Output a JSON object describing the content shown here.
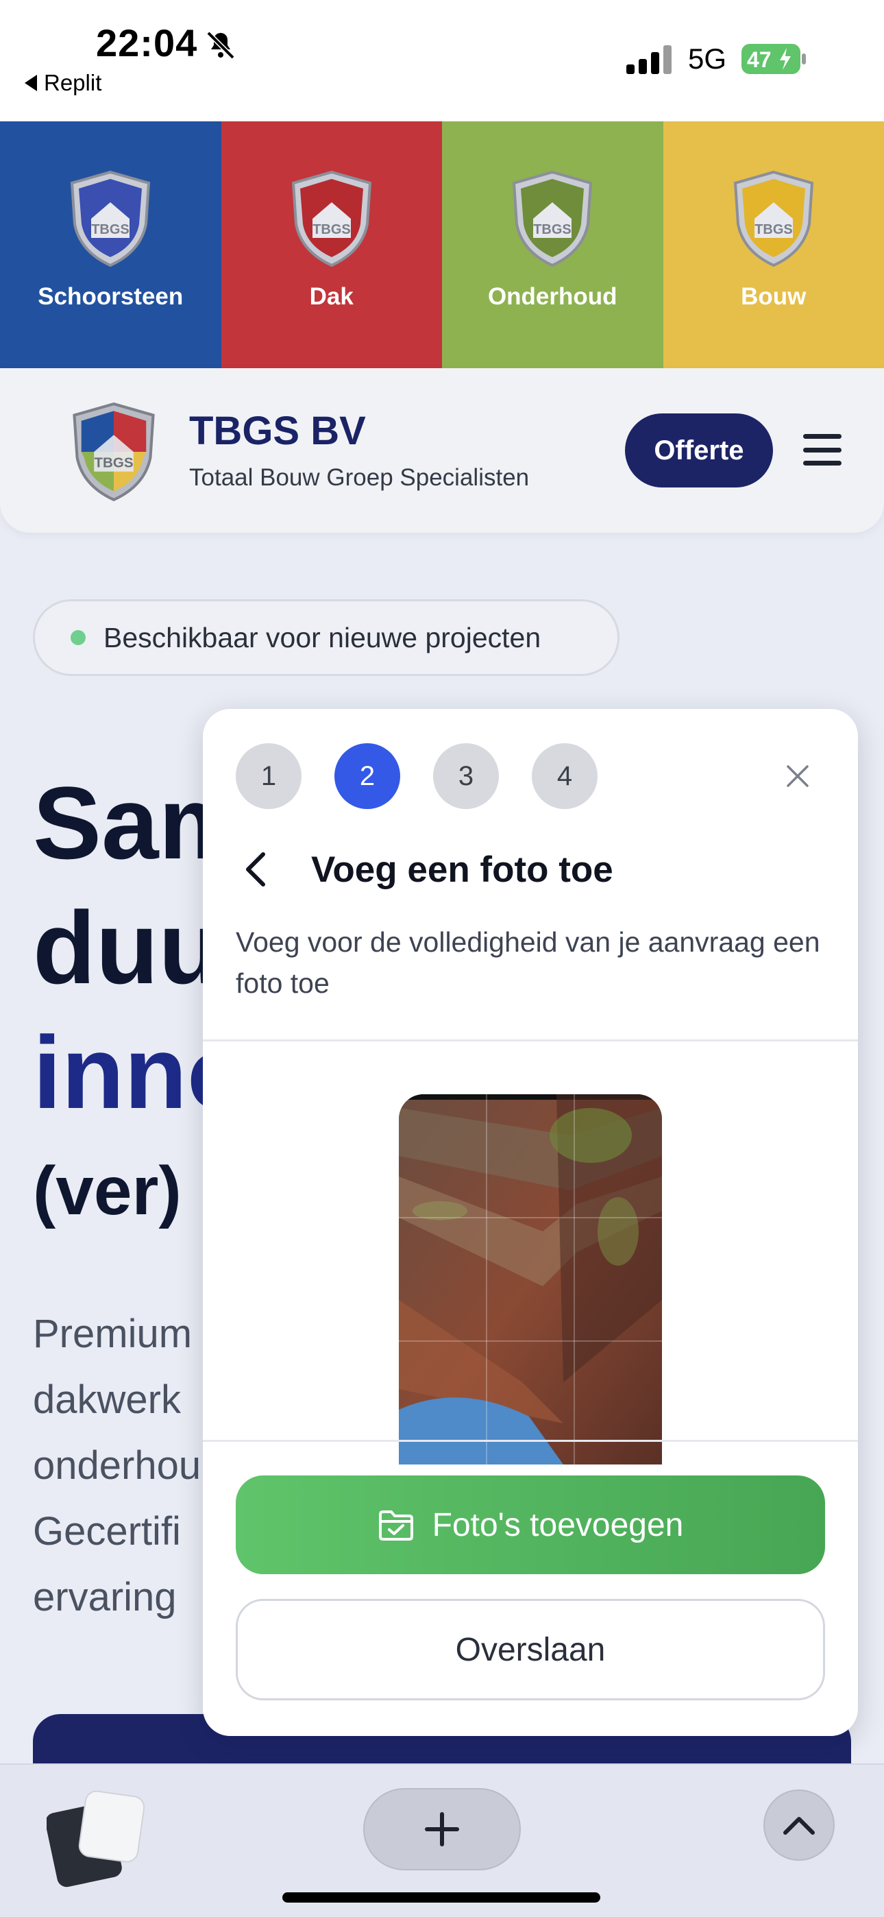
{
  "status_bar": {
    "time": "22:04",
    "back_app": "Replit",
    "network": "5G",
    "battery": "47",
    "icons": [
      "bell-slash-icon",
      "signal-icon",
      "battery-charging-icon"
    ]
  },
  "categories": [
    {
      "label": "Schoorsteen",
      "color": "#22529f"
    },
    {
      "label": "Dak",
      "color": "#c2353b"
    },
    {
      "label": "Onderhoud",
      "color": "#8eb250"
    },
    {
      "label": "Bouw",
      "color": "#e6bf4a"
    }
  ],
  "header": {
    "brand": "TBGS BV",
    "tagline": "Totaal Bouw Groep Specialisten",
    "cta": "Offerte",
    "menu_icon": "hamburger-icon"
  },
  "hero": {
    "badge": "Beschikbaar voor nieuwe projecten",
    "line1": "Sam",
    "line2": "duu",
    "line3": "inno",
    "line4": "(ver)",
    "para1": "Premium",
    "para2": "dakwerk",
    "para3": "onderhou",
    "para4": "Gecertifi",
    "para5": "ervaring"
  },
  "modal": {
    "steps": [
      "1",
      "2",
      "3",
      "4"
    ],
    "active_step": 2,
    "title": "Voeg een foto toe",
    "description": "Voeg voor de volledigheid van je aanvraag een foto toe",
    "add_button": "Foto's toevoegen",
    "skip_button": "Overslaan"
  },
  "colors": {
    "primary": "#1c2466",
    "accent_blue": "#3359e6",
    "green": "#5fc46a"
  }
}
